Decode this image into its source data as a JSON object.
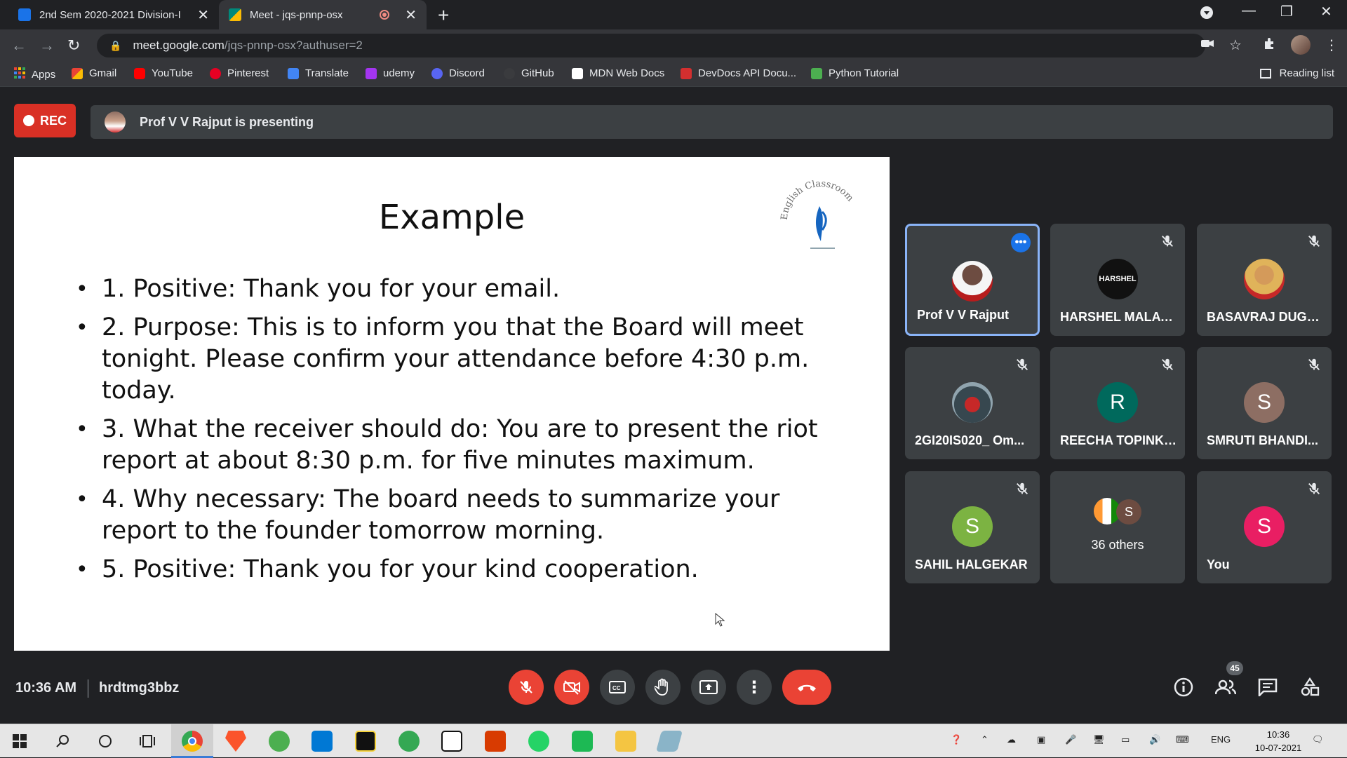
{
  "browser": {
    "tabs": [
      {
        "title": "2nd Sem 2020-2021 Division-I",
        "favicon_color": "#1a73e8",
        "active": false
      },
      {
        "title": "Meet - jqs-pnnp-osx",
        "favicon_color": "#00897b",
        "active": true
      }
    ],
    "address": {
      "host": "meet.google.com",
      "path": "/jqs-pnnp-osx?authuser=2"
    },
    "bookmarks": [
      {
        "label": "Apps",
        "color": "#4285f4"
      },
      {
        "label": "Gmail",
        "color": "#ea4335"
      },
      {
        "label": "YouTube",
        "color": "#ff0000"
      },
      {
        "label": "Pinterest",
        "color": "#e60023"
      },
      {
        "label": "Translate",
        "color": "#4285f4"
      },
      {
        "label": "udemy",
        "color": "#a435f0"
      },
      {
        "label": "Discord",
        "color": "#5865f2"
      },
      {
        "label": "GitHub",
        "color": "#24292e"
      },
      {
        "label": "MDN Web Docs",
        "color": "#ffffff"
      },
      {
        "label": "DevDocs API Docu...",
        "color": "#d32f2f"
      },
      {
        "label": "Python Tutorial",
        "color": "#4caf50"
      }
    ],
    "reading_list": "Reading list"
  },
  "meet": {
    "rec_label": "REC",
    "presenting_text": "Prof V V Rajput is presenting",
    "slide": {
      "title": "Example",
      "bullets": [
        "1. Positive: Thank you for your email.",
        "2. Purpose: This is to inform you that the Board will meet tonight. Please confirm your attendance before 4:30 p.m. today.",
        "3. What the receiver should do: You are to present the riot report at about 8:30 p.m. for five minutes maximum.",
        "4. Why necessary: The board needs to summarize your report to the founder tomorrow morning.",
        "5. Positive: Thank you for your kind cooperation."
      ],
      "logo_text": "English Classroom"
    },
    "participants": [
      {
        "name": "Prof V V Rajput",
        "initial": "",
        "avatar_color": "#8d6e63",
        "muted": false,
        "active": true
      },
      {
        "name": "HARSHEL MALAW...",
        "initial": "HARSHEL",
        "avatar_color": "#111111",
        "muted": true,
        "active": false
      },
      {
        "name": "BASAVRAJ DUGA...",
        "initial": "",
        "avatar_color": "#e0b35a",
        "muted": true,
        "active": false
      },
      {
        "name": "2GI20IS020_ Om...",
        "initial": "",
        "avatar_color": "#607d8b",
        "muted": true,
        "active": false
      },
      {
        "name": "REECHA TOPINKA...",
        "initial": "R",
        "avatar_color": "#00695c",
        "muted": true,
        "active": false
      },
      {
        "name": "SMRUTI BHANDI...",
        "initial": "S",
        "avatar_color": "#8d6e63",
        "muted": true,
        "active": false
      },
      {
        "name": "SAHIL HALGEKAR",
        "initial": "S",
        "avatar_color": "#7cb342",
        "muted": true,
        "active": false
      },
      {
        "name": "36 others",
        "initial": "S",
        "avatar_color": "#6d4c41",
        "muted": false,
        "active": false
      },
      {
        "name": "You",
        "initial": "S",
        "avatar_color": "#e91e63",
        "muted": true,
        "active": false
      }
    ],
    "time": "10:36 AM",
    "meeting_code": "hrdtmg3bbz",
    "people_count": "45"
  },
  "taskbar": {
    "lang": "ENG",
    "time": "10:36",
    "date": "10-07-2021"
  }
}
